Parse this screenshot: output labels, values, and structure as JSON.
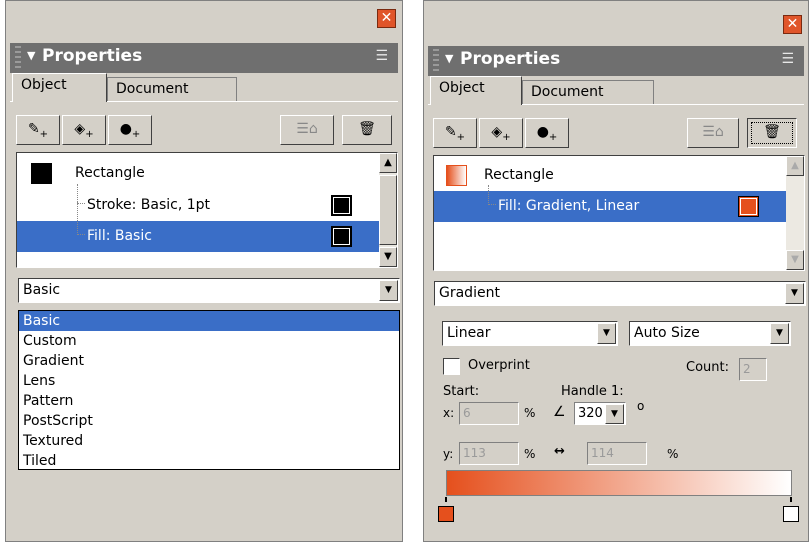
{
  "left": {
    "title": "Properties",
    "tabs": [
      "Object",
      "Document"
    ],
    "tree": [
      {
        "label": "Rectangle",
        "color": "#000000"
      },
      {
        "label": "Stroke: Basic, 1pt",
        "color": "#000000"
      },
      {
        "label": "Fill: Basic",
        "color": "#000000"
      }
    ],
    "fill_type": "Basic",
    "options": [
      "Basic",
      "Custom",
      "Gradient",
      "Lens",
      "Pattern",
      "PostScript",
      "Textured",
      "Tiled"
    ]
  },
  "right": {
    "title": "Properties",
    "tabs": [
      "Object",
      "Document"
    ],
    "tree": [
      {
        "label": "Rectangle"
      },
      {
        "label": "Fill: Gradient, Linear",
        "color": "#e5501d"
      }
    ],
    "fill_type": "Gradient",
    "gradient_type": "Linear",
    "size_mode": "Auto Size",
    "overprint_label": "Overprint",
    "count_label": "Count:",
    "count_value": "2",
    "start_label": "Start:",
    "handle_label": "Handle 1:",
    "x_label": "x:",
    "x_value": "6",
    "y_label": "y:",
    "y_value": "113",
    "pct": "%",
    "angle_value": "320",
    "degree": "o",
    "width_value": "114",
    "gradient_colors": [
      "#e5501d",
      "#ffffff"
    ]
  }
}
